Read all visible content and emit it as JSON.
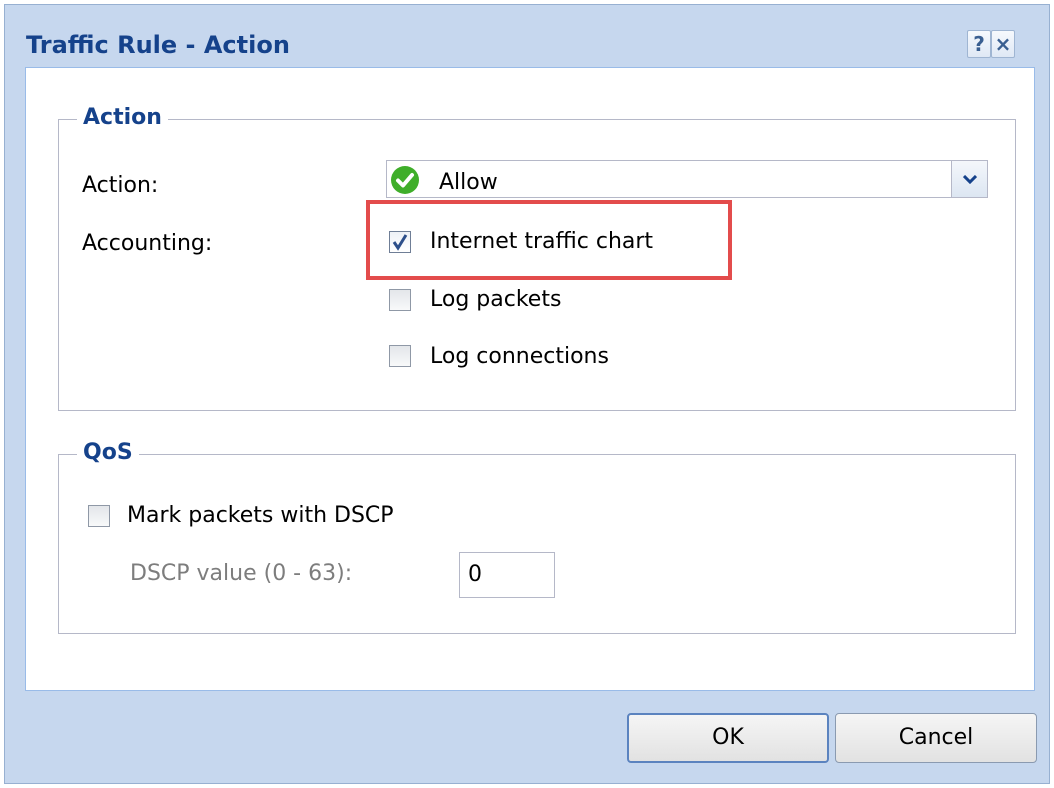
{
  "dialog": {
    "title": "Traffic Rule - Action",
    "help_label": "?",
    "close_label": "×"
  },
  "action_section": {
    "legend": "Action",
    "action_label": "Action:",
    "action_value": "Allow",
    "action_icon": "check-circle-icon",
    "accounting_label": "Accounting:",
    "options": [
      {
        "label": "Internet traffic chart",
        "checked": true
      },
      {
        "label": "Log packets",
        "checked": false
      },
      {
        "label": "Log connections",
        "checked": false
      }
    ]
  },
  "qos_section": {
    "legend": "QoS",
    "mark_label": "Mark packets with DSCP",
    "mark_checked": false,
    "dscp_label": "DSCP value (0 - 63):",
    "dscp_value": "0"
  },
  "buttons": {
    "ok": "OK",
    "cancel": "Cancel"
  },
  "colors": {
    "highlight": "#e34c4c",
    "allow_icon": "#3fae2a",
    "title_text": "#15428b"
  }
}
